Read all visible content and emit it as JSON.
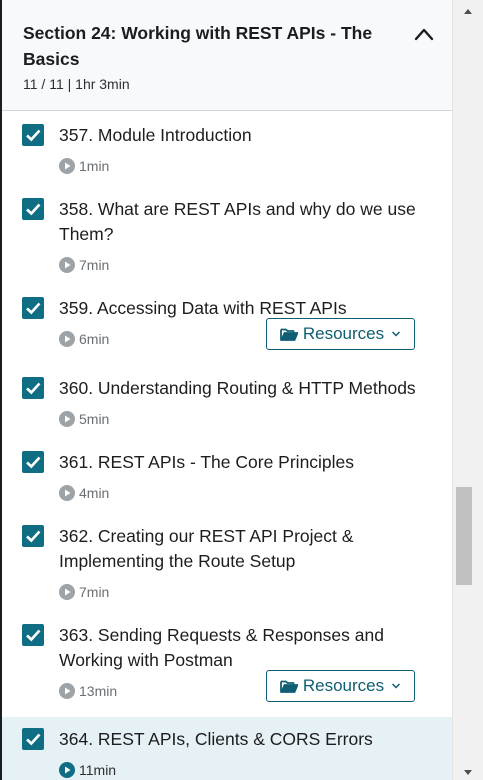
{
  "section": {
    "title": "Section 24: Working with REST APIs - The Basics",
    "meta": "11 / 11 | 1hr 3min"
  },
  "lectures": [
    {
      "title": "357. Module Introduction",
      "duration": "1min",
      "completed": true,
      "resources": false
    },
    {
      "title": "358. What are REST APIs and why do we use Them?",
      "duration": "7min",
      "completed": true,
      "resources": false
    },
    {
      "title": "359. Accessing Data with REST APIs",
      "duration": "6min",
      "completed": true,
      "resources": true
    },
    {
      "title": "360. Understanding Routing & HTTP Methods",
      "duration": "5min",
      "completed": true,
      "resources": false
    },
    {
      "title": "361. REST APIs - The Core Principles",
      "duration": "4min",
      "completed": true,
      "resources": false
    },
    {
      "title": "362. Creating our REST API Project & Implementing the Route Setup",
      "duration": "7min",
      "completed": true,
      "resources": false
    },
    {
      "title": "363. Sending Requests & Responses and Working with Postman",
      "duration": "13min",
      "completed": true,
      "resources": true
    },
    {
      "title": "364. REST APIs, Clients & CORS Errors",
      "duration": "11min",
      "completed": true,
      "resources": false,
      "active": true
    }
  ],
  "resources_label": "Resources",
  "icons": {
    "checkbox": "checkbox-checked-icon",
    "play": "play-circle-icon",
    "folder": "folder-open-icon",
    "chevron_up": "chevron-up-icon",
    "chevron_down": "chevron-down-icon"
  },
  "colors": {
    "accent": "#0f6e84",
    "active_bg": "#e6f1f5",
    "header_bg": "#f7f9fa"
  }
}
